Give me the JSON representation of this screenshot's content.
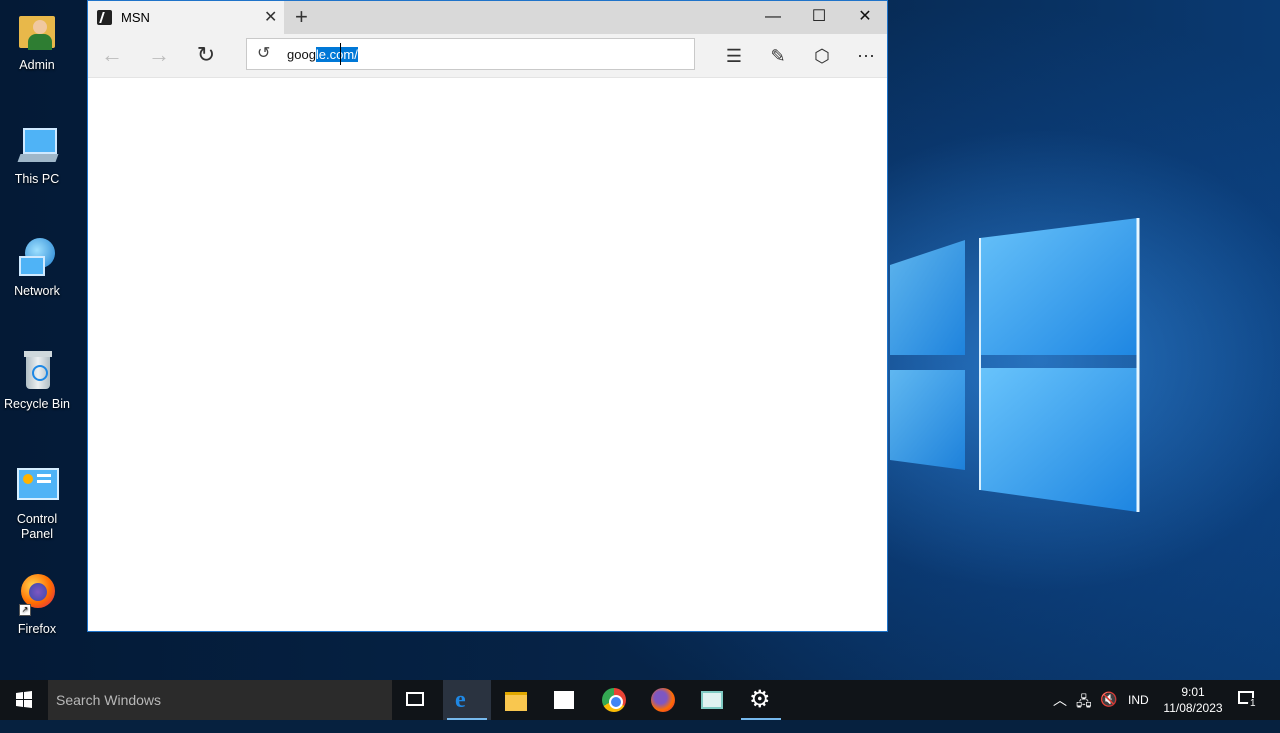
{
  "desktop": {
    "icons": [
      {
        "label": "Admin",
        "icon": "user-folder-icon"
      },
      {
        "label": "This PC",
        "icon": "computer-icon"
      },
      {
        "label": "Network",
        "icon": "network-globe-icon"
      },
      {
        "label": "Recycle Bin",
        "icon": "recycle-bin-icon"
      },
      {
        "label": "Control Panel",
        "icon": "control-panel-icon"
      },
      {
        "label": "Firefox",
        "icon": "firefox-icon"
      }
    ]
  },
  "browser": {
    "tab_title": "MSN",
    "address_plain": "goog",
    "address_selected": "le.com/",
    "icons": [
      "back-icon",
      "forward-icon",
      "refresh-icon",
      "history-icon",
      "hub-icon",
      "web-note-icon",
      "share-icon",
      "more-icon"
    ]
  },
  "taskbar": {
    "search_placeholder": "Search Windows",
    "language": "IND",
    "time": "9:01",
    "date": "11/08/2023",
    "notification_count": "1"
  },
  "colors": {
    "selection": "#0078d7",
    "taskbar": "#101418",
    "accent": "#76b9ed"
  }
}
